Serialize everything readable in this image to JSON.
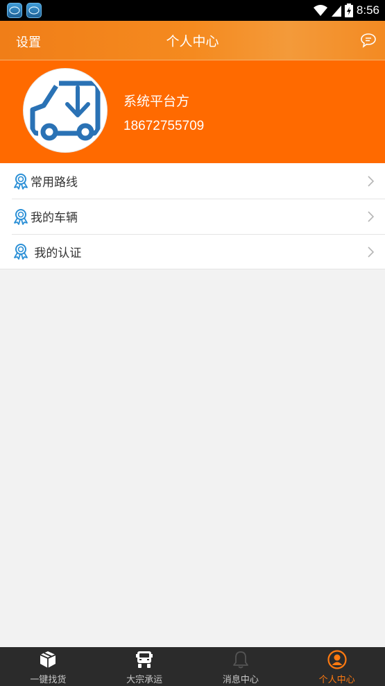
{
  "status_bar": {
    "time": "8:56",
    "notification_icons": [
      "app-notification-icon",
      "app-notification-icon"
    ]
  },
  "header": {
    "settings_label": "设置",
    "title": "个人中心",
    "chat_icon": "chat-bubble-icon"
  },
  "profile": {
    "name": "系统平台方",
    "phone": "18672755709",
    "avatar_icon": "truck-download-icon"
  },
  "menu": {
    "items": [
      {
        "label": "常用路线",
        "icon": "badge-icon"
      },
      {
        "label": "我的车辆",
        "icon": "badge-icon"
      },
      {
        "label": " 我的认证",
        "icon": "badge-icon"
      }
    ]
  },
  "bottom_nav": {
    "items": [
      {
        "label": "一键找货",
        "icon": "box-icon",
        "active": false
      },
      {
        "label": "大宗承运",
        "icon": "truck-icon",
        "active": false
      },
      {
        "label": "消息中心",
        "icon": "bell-icon",
        "active": false
      },
      {
        "label": "个人中心",
        "icon": "user-circle-icon",
        "active": true
      }
    ]
  },
  "colors": {
    "header": "#f58a1f",
    "profile_bg": "#ff6a00",
    "accent_blue": "#2a72b5",
    "nav_bg": "#2b2b2b",
    "nav_active": "#ff7a10"
  }
}
